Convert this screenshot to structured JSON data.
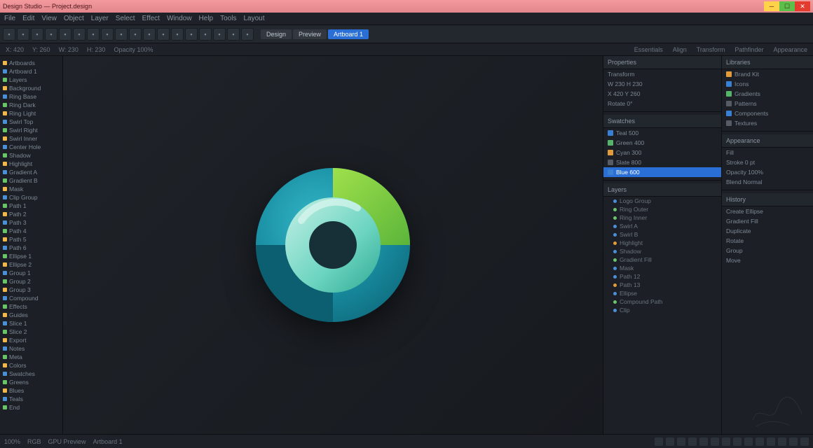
{
  "os": {
    "title": "Design Studio — Project.design"
  },
  "menu": [
    "File",
    "Edit",
    "View",
    "Object",
    "Layer",
    "Select",
    "Effect",
    "Window",
    "Help",
    "Tools",
    "Layout"
  ],
  "toolbar": {
    "icons": [
      "new",
      "open",
      "save",
      "undo",
      "redo",
      "cut",
      "copy",
      "paste",
      "align-l",
      "align-c",
      "align-r",
      "grid",
      "snap",
      "zoom",
      "hand",
      "text",
      "shape",
      "pen"
    ],
    "tabs": [
      {
        "label": "Design",
        "active": false
      },
      {
        "label": "Preview",
        "active": false
      },
      {
        "label": "Artboard 1",
        "active": true
      }
    ]
  },
  "ctx": {
    "left": [
      "X: 420",
      "Y: 260",
      "W: 230",
      "H: 230",
      "Opacity 100%"
    ],
    "right": [
      "Essentials",
      "Align",
      "Transform",
      "Pathfinder",
      "Appearance"
    ]
  },
  "explorer": {
    "items": [
      "Artboards",
      "Artboard 1",
      "Layers",
      "Background",
      "Ring Base",
      "Ring Dark",
      "Ring Light",
      "Swirl Top",
      "Swirl Right",
      "Swirl Inner",
      "Center Hole",
      "Shadow",
      "Highlight",
      "Gradient A",
      "Gradient B",
      "Mask",
      "Clip Group",
      "Path 1",
      "Path 2",
      "Path 3",
      "Path 4",
      "Path 5",
      "Path 6",
      "Ellipse 1",
      "Ellipse 2",
      "Group 1",
      "Group 2",
      "Group 3",
      "Compound",
      "Effects",
      "Guides",
      "Slice 1",
      "Slice 2",
      "Export",
      "Notes",
      "Meta",
      "Colors",
      "Swatches",
      "Greens",
      "Blues",
      "Teals",
      "End"
    ]
  },
  "panelA": {
    "sec1_title": "Properties",
    "sec1_rows": [
      "Transform",
      "W 230  H 230",
      "X 420  Y 260",
      "Rotate 0°"
    ],
    "sec2_title": "Swatches",
    "sec2_rows": [
      {
        "c": "sq",
        "t": "Teal 500"
      },
      {
        "c": "sq g",
        "t": "Green 400"
      },
      {
        "c": "sq o",
        "t": "Cyan 300"
      },
      {
        "c": "sq gr",
        "t": "Slate 800"
      },
      {
        "c": "sq",
        "t": "Blue 600"
      }
    ],
    "sec2_selected": 4,
    "sec3_title": "Layers",
    "tree": [
      {
        "c": "bullet",
        "t": "Logo Group"
      },
      {
        "c": "bullet g",
        "t": "Ring Outer"
      },
      {
        "c": "bullet g",
        "t": "Ring Inner"
      },
      {
        "c": "bullet",
        "t": "Swirl A"
      },
      {
        "c": "bullet",
        "t": "Swirl B"
      },
      {
        "c": "bullet o",
        "t": "Highlight"
      },
      {
        "c": "bullet",
        "t": "Shadow"
      },
      {
        "c": "bullet g",
        "t": "Gradient Fill"
      },
      {
        "c": "bullet",
        "t": "Mask"
      },
      {
        "c": "bullet",
        "t": "Path 12"
      },
      {
        "c": "bullet o",
        "t": "Path 13"
      },
      {
        "c": "bullet",
        "t": "Ellipse"
      },
      {
        "c": "bullet g",
        "t": "Compound Path"
      },
      {
        "c": "bullet",
        "t": "Clip"
      }
    ]
  },
  "panelB": {
    "sec1_title": "Libraries",
    "rows1": [
      {
        "c": "sq o",
        "t": "Brand Kit"
      },
      {
        "c": "sq",
        "t": "Icons"
      },
      {
        "c": "sq g",
        "t": "Gradients"
      },
      {
        "c": "sq gr",
        "t": "Patterns"
      },
      {
        "c": "sq",
        "t": "Components"
      },
      {
        "c": "sq gr",
        "t": "Textures"
      }
    ],
    "sec2_title": "Appearance",
    "rows2": [
      "Fill",
      "Stroke 0 pt",
      "Opacity 100%",
      "Blend Normal"
    ],
    "sec3_title": "History",
    "rows3": [
      "Create Ellipse",
      "Gradient Fill",
      "Duplicate",
      "Rotate",
      "Group",
      "Move"
    ]
  },
  "status": {
    "left": [
      "100%",
      "RGB",
      "GPU Preview",
      "Artboard 1"
    ],
    "right_icons": 14
  },
  "logo_colors": {
    "outer_green": "#7ac943",
    "outer_teal": "#1fa7b5",
    "outer_dark": "#0e6b7d",
    "inner_light": "#a8e6d8",
    "inner_mid": "#4fcab5"
  }
}
